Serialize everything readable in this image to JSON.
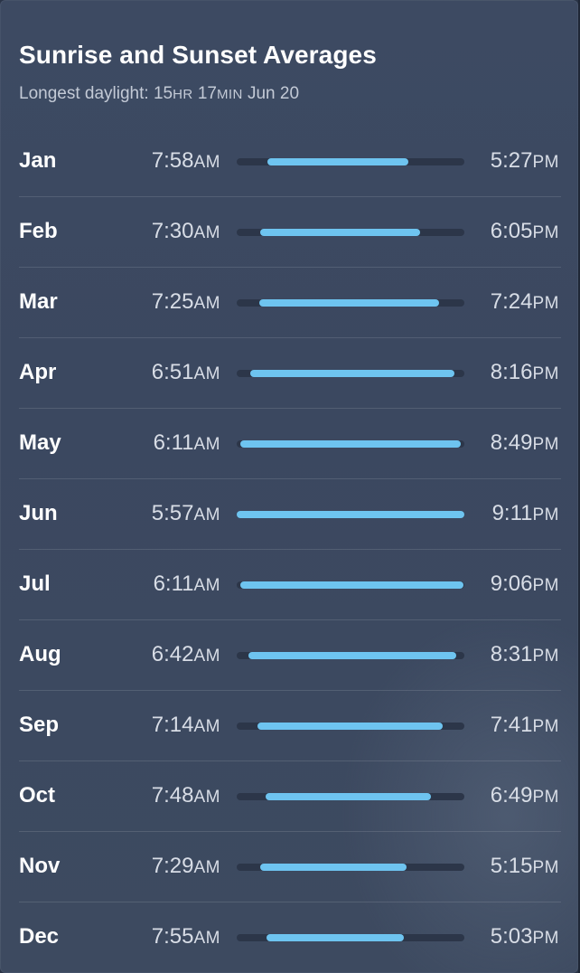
{
  "header": {
    "title": "Sunrise and Sunset Averages",
    "subtitle_prefix": "Longest daylight: ",
    "hours_value": "15",
    "hours_unit": "HR",
    "minutes_value": "17",
    "minutes_unit": "MIN",
    "date": "Jun 20"
  },
  "colors": {
    "bar_fill": "#6ec4f0",
    "bar_track": "#2c3649",
    "panel_bg": "#3c4961"
  },
  "months": [
    {
      "name": "Jan",
      "sunrise": "7:58",
      "sunrise_suffix": "AM",
      "sunset": "5:27",
      "sunset_suffix": "PM",
      "bar_start": 0.135,
      "bar_end": 0.755
    },
    {
      "name": "Feb",
      "sunrise": "7:30",
      "sunrise_suffix": "AM",
      "sunset": "6:05",
      "sunset_suffix": "PM",
      "bar_start": 0.105,
      "bar_end": 0.805
    },
    {
      "name": "Mar",
      "sunrise": "7:25",
      "sunrise_suffix": "AM",
      "sunset": "7:24",
      "sunset_suffix": "PM",
      "bar_start": 0.1,
      "bar_end": 0.89
    },
    {
      "name": "Apr",
      "sunrise": "6:51",
      "sunrise_suffix": "AM",
      "sunset": "8:16",
      "sunset_suffix": "PM",
      "bar_start": 0.06,
      "bar_end": 0.955
    },
    {
      "name": "May",
      "sunrise": "6:11",
      "sunrise_suffix": "AM",
      "sunset": "8:49",
      "sunset_suffix": "PM",
      "bar_start": 0.015,
      "bar_end": 0.985
    },
    {
      "name": "Jun",
      "sunrise": "5:57",
      "sunrise_suffix": "AM",
      "sunset": "9:11",
      "sunset_suffix": "PM",
      "bar_start": 0.0,
      "bar_end": 1.0
    },
    {
      "name": "Jul",
      "sunrise": "6:11",
      "sunrise_suffix": "AM",
      "sunset": "9:06",
      "sunset_suffix": "PM",
      "bar_start": 0.015,
      "bar_end": 0.995
    },
    {
      "name": "Aug",
      "sunrise": "6:42",
      "sunrise_suffix": "AM",
      "sunset": "8:31",
      "sunset_suffix": "PM",
      "bar_start": 0.05,
      "bar_end": 0.965
    },
    {
      "name": "Sep",
      "sunrise": "7:14",
      "sunrise_suffix": "AM",
      "sunset": "7:41",
      "sunset_suffix": "PM",
      "bar_start": 0.09,
      "bar_end": 0.905
    },
    {
      "name": "Oct",
      "sunrise": "7:48",
      "sunrise_suffix": "AM",
      "sunset": "6:49",
      "sunset_suffix": "PM",
      "bar_start": 0.125,
      "bar_end": 0.855
    },
    {
      "name": "Nov",
      "sunrise": "7:29",
      "sunrise_suffix": "AM",
      "sunset": "5:15",
      "sunset_suffix": "PM",
      "bar_start": 0.105,
      "bar_end": 0.745
    },
    {
      "name": "Dec",
      "sunrise": "7:55",
      "sunrise_suffix": "AM",
      "sunset": "5:03",
      "sunset_suffix": "PM",
      "bar_start": 0.13,
      "bar_end": 0.735
    }
  ]
}
